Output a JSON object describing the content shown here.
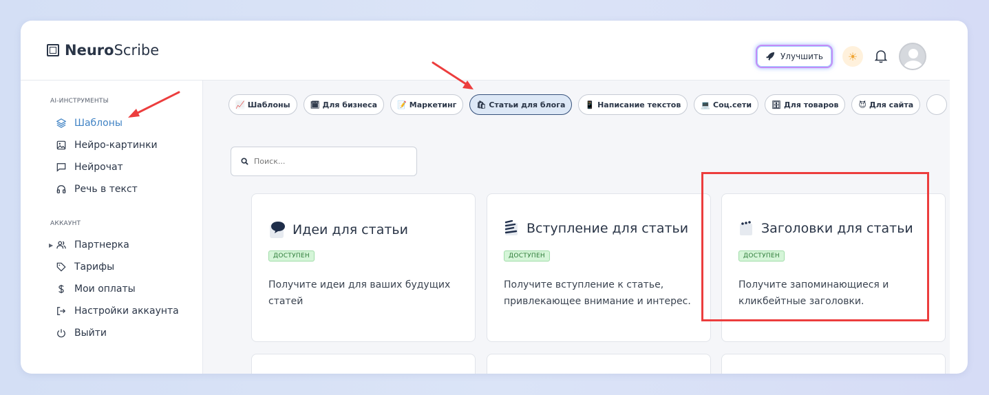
{
  "brand": {
    "bold": "Neuro",
    "light": "Scribe"
  },
  "header": {
    "upgrade_label": "Улучшить"
  },
  "sidebar": {
    "section1_title": "AI-ИНСТРУМЕНТЫ",
    "section2_title": "АККАУНТ",
    "items": [
      {
        "label": "Шаблоны",
        "icon": "layers-icon"
      },
      {
        "label": "Нейро-картинки",
        "icon": "image-icon"
      },
      {
        "label": "Нейрочат",
        "icon": "chat-icon"
      },
      {
        "label": "Речь в текст",
        "icon": "headphones-icon"
      },
      {
        "label": "Партнерка",
        "icon": "users-icon"
      },
      {
        "label": "Тарифы",
        "icon": "tag-icon"
      },
      {
        "label": "Мои оплаты",
        "icon": "dollar-icon"
      },
      {
        "label": "Настройки аккаунта",
        "icon": "login-icon"
      },
      {
        "label": "Выйти",
        "icon": "power-icon"
      }
    ]
  },
  "chips": [
    {
      "emoji": "📈",
      "label": "Шаблоны"
    },
    {
      "emoji": "🗓",
      "label": "Для бизнеса"
    },
    {
      "emoji": "📝",
      "label": "Маркетинг"
    },
    {
      "emoji": "🛍",
      "label": "Статьи для блога"
    },
    {
      "emoji": "📱",
      "label": "Написание текстов"
    },
    {
      "emoji": "💻",
      "label": "Соц.сети"
    },
    {
      "emoji": "🗄",
      "label": "Для товаров"
    },
    {
      "emoji": "😈",
      "label": "Для сайта"
    }
  ],
  "search": {
    "placeholder": "Поиск..."
  },
  "cards": [
    {
      "title": "Идеи для статьи",
      "badge": "ДОСТУПЕН",
      "desc": "Получите идеи для ваших будущих статей"
    },
    {
      "title": "Вступление для статьи",
      "badge": "ДОСТУПЕН",
      "desc": "Получите вступление к статье, привлекающее внимание и интерес."
    },
    {
      "title": "Заголовки для статьи",
      "badge": "ДОСТУПЕН",
      "desc": "Получите запоминающиеся и кликбейтные заголовки."
    }
  ],
  "colors": {
    "accent": "#3f82c4",
    "highlight": "#ec3d3d",
    "badge_bg": "#d5f5d8"
  }
}
